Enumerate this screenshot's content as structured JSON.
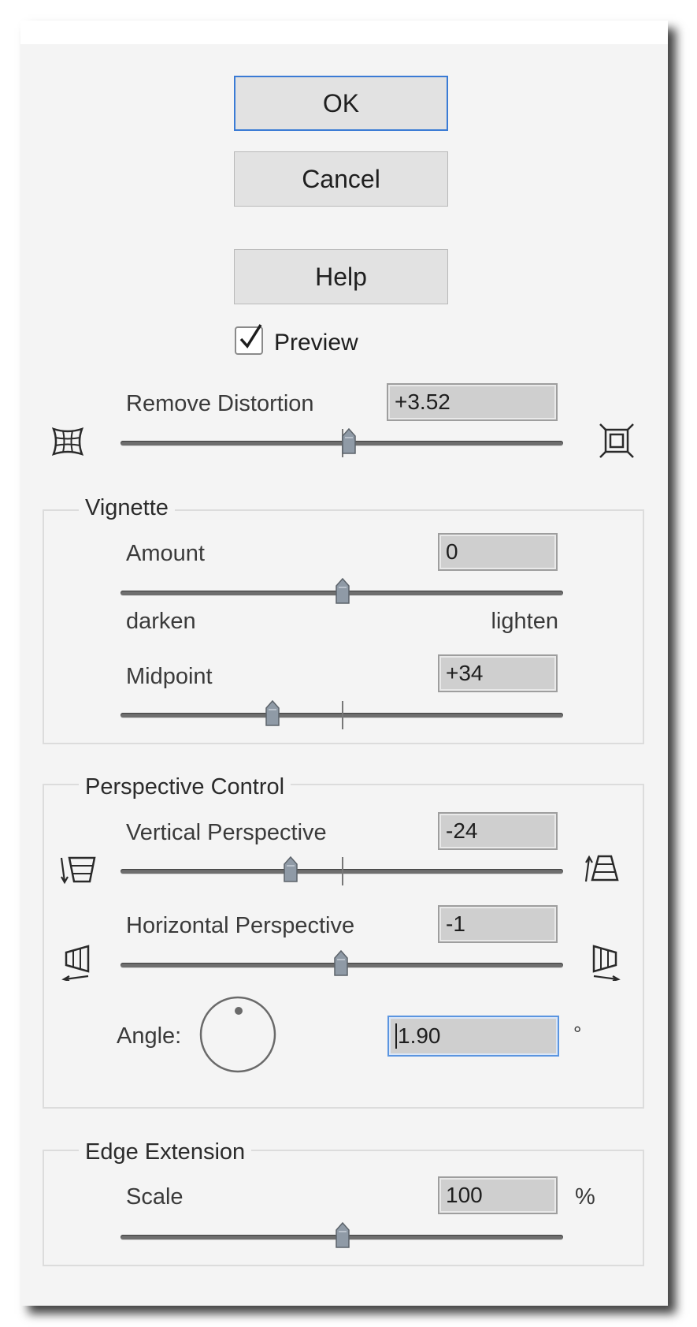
{
  "buttons": {
    "ok": "OK",
    "cancel": "Cancel",
    "help": "Help"
  },
  "preview": {
    "label": "Preview",
    "checked": true
  },
  "remove_distortion": {
    "label": "Remove Distortion",
    "value": "+3.52",
    "left_icon": "pincushion-grid-icon",
    "right_icon": "barrel-frame-icon"
  },
  "vignette": {
    "title": "Vignette",
    "amount": {
      "label": "Amount",
      "value": "0",
      "min_label": "darken",
      "max_label": "lighten"
    },
    "midpoint": {
      "label": "Midpoint",
      "value": "+34"
    }
  },
  "perspective": {
    "title": "Perspective Control",
    "vertical": {
      "label": "Vertical Perspective",
      "value": "-24",
      "left_icon": "vertical-perspective-down-icon",
      "right_icon": "vertical-perspective-up-icon"
    },
    "horizontal": {
      "label": "Horizontal Perspective",
      "value": "-1",
      "left_icon": "horizontal-perspective-left-icon",
      "right_icon": "horizontal-perspective-right-icon"
    },
    "angle": {
      "label": "Angle:",
      "value": "1.90",
      "unit": "°"
    }
  },
  "edge_extension": {
    "title": "Edge Extension",
    "scale": {
      "label": "Scale",
      "value": "100",
      "unit": "%"
    }
  },
  "colors": {
    "panel": "#f4f4f4",
    "focus": "#3a7bd5"
  }
}
